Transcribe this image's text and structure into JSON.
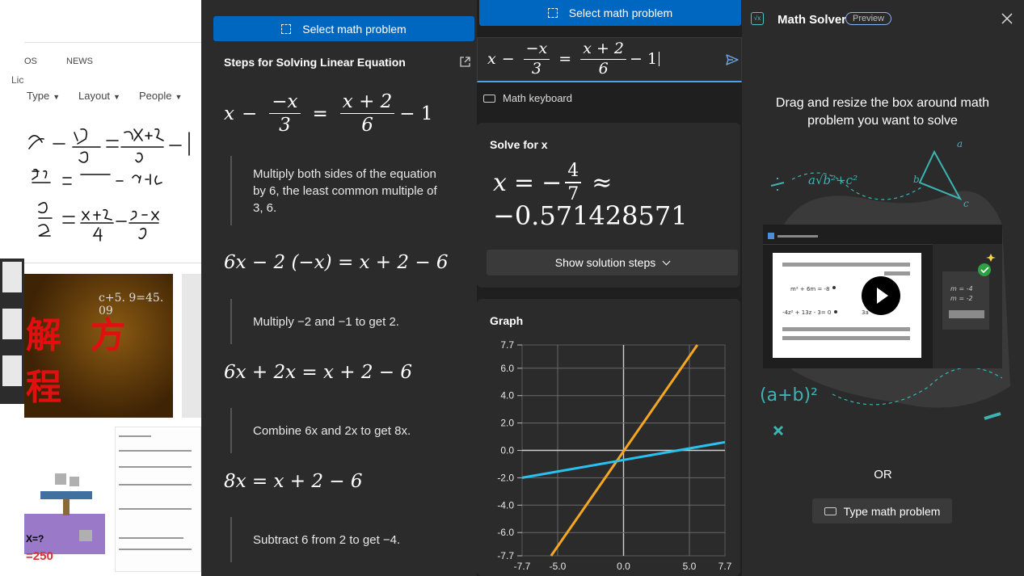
{
  "browser": {
    "tab_partial": "OS",
    "tab_news": "NEWS",
    "partial_label": "Lic",
    "filters": [
      {
        "label": "Type"
      },
      {
        "label": "Layout"
      },
      {
        "label": "People"
      }
    ],
    "red_tile_title": "解 方 程",
    "red_tile_eq": "c+5. 9=45. 09",
    "scale_tile_x": "X=?",
    "scale_tile_value": "=250"
  },
  "steps_panel": {
    "select_button": "Select math problem",
    "title": "Steps for Solving Linear Equation",
    "equation": {
      "lhs": "x",
      "minus": "−",
      "frac1_num": "−x",
      "frac1_den": "3",
      "eq": "=",
      "frac2_num": "x + 2",
      "frac2_den": "6",
      "tail": "− 1"
    },
    "steps": [
      {
        "explain_lines": [
          "Multiply both sides of the equation",
          "by 6, the least common multiple of",
          "3, 6."
        ]
      },
      {
        "equation": "6x − 2 (−x) = x + 2 − 6"
      },
      {
        "explain_lines": [
          "Multiply −2 and −1 to get 2."
        ]
      },
      {
        "equation": "6x + 2x = x + 2 − 6"
      },
      {
        "explain_lines": [
          "Combine 6x and 2x to get 8x."
        ]
      },
      {
        "equation": "8x = x + 2 − 6"
      },
      {
        "explain_lines": [
          "Subtract 6 from 2 to get −4."
        ]
      }
    ]
  },
  "solver": {
    "select_button": "Select math problem",
    "input_equation": {
      "lhs": "x",
      "minus": "−",
      "frac1_num": "−x",
      "frac1_den": "3",
      "eq": "=",
      "frac2_num": "x + 2",
      "frac2_den": "6",
      "tail": "− 1"
    },
    "math_keyboard": "Math keyboard",
    "solve_title": "Solve for x",
    "result": {
      "var": "x",
      "eq": "=",
      "sign": "−",
      "num": "4",
      "den": "7",
      "approx": "≈",
      "decimal": "−0.571428571"
    },
    "show_steps_button": "Show solution steps",
    "graph_title": "Graph"
  },
  "chart_data": {
    "type": "line",
    "title": "Graph",
    "xlabel": "",
    "ylabel": "",
    "xlim": [
      -7.7,
      7.7
    ],
    "ylim": [
      -7.7,
      7.7
    ],
    "x_ticks": [
      "-7.7",
      "-5.0",
      "0.0",
      "5.0",
      "7.7"
    ],
    "y_ticks": [
      "7.7",
      "6.0",
      "4.0",
      "2.0",
      "0.0",
      "-2.0",
      "-4.0",
      "-6.0",
      "-7.7"
    ],
    "grid": true,
    "series": [
      {
        "color": "#f5a623",
        "x": [
          -5.5,
          5.6
        ],
        "y": [
          -7.7,
          7.7
        ]
      },
      {
        "color": "#29c2f0",
        "x": [
          -7.7,
          7.7
        ],
        "y": [
          -2.0,
          0.6
        ]
      }
    ]
  },
  "pane": {
    "app_title": "Math Solver",
    "badge": "Preview",
    "instruction": "Drag and resize the box around math problem you want to solve",
    "illustration": {
      "line1": "m² + 6m = -8",
      "line2": "-4z² + 13z - 3= 0",
      "line3": "3a",
      "side1": "m = -4",
      "side2": "m = -2",
      "doodle1": "(a+b)²",
      "doodle2": "a√b²+c²",
      "tri_a": "a",
      "tri_b": "b",
      "tri_c": "c"
    },
    "or_text": "OR",
    "type_button": "Type math problem"
  },
  "colors": {
    "accent_blue": "#0067c0",
    "graph_orange": "#f5a623",
    "graph_cyan": "#29c2f0",
    "doodle_teal": "#3cb4b4"
  }
}
